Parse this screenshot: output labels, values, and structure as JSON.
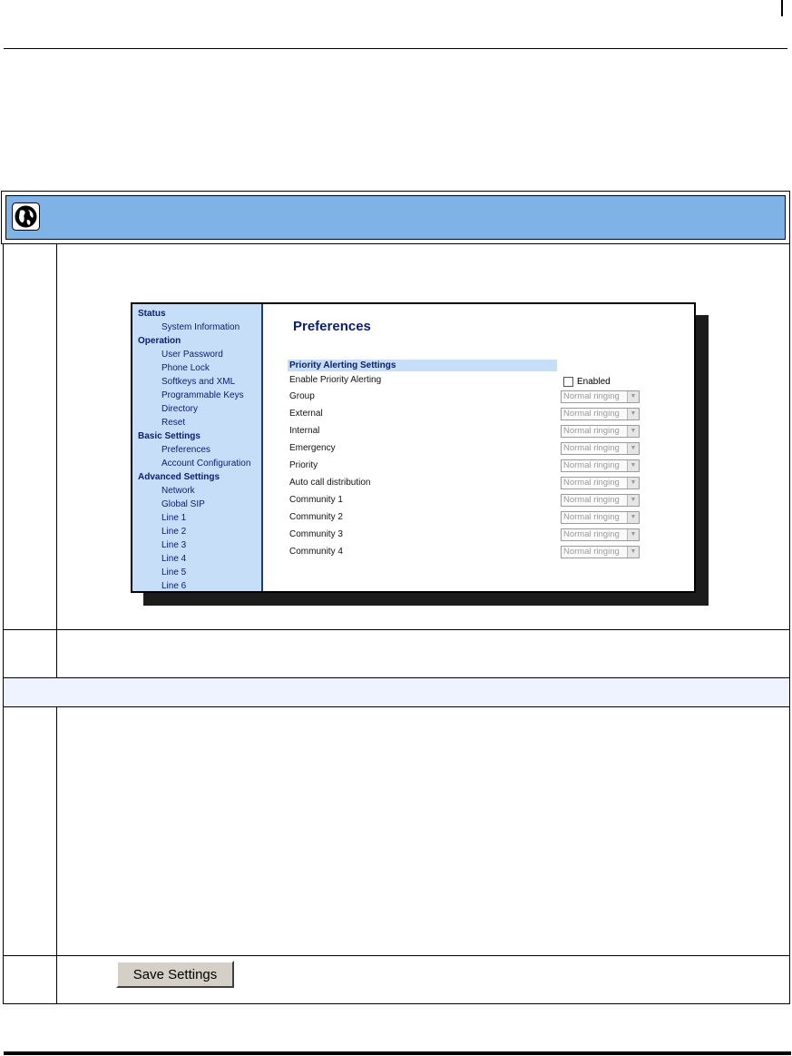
{
  "icons": {
    "banner": "globe-icon",
    "select_arrow": "dropdown-arrow-icon"
  },
  "colors": {
    "banner": "#7fb2e5",
    "nav_bg": "#c6def8",
    "nav_text": "#0b1e6e"
  },
  "nav": {
    "items": [
      {
        "label": "Status",
        "type": "head"
      },
      {
        "label": "System Information",
        "type": "item"
      },
      {
        "label": "Operation",
        "type": "head"
      },
      {
        "label": "User Password",
        "type": "item"
      },
      {
        "label": "Phone Lock",
        "type": "item"
      },
      {
        "label": "Softkeys and XML",
        "type": "item"
      },
      {
        "label": "Programmable Keys",
        "type": "item"
      },
      {
        "label": "Directory",
        "type": "item"
      },
      {
        "label": "Reset",
        "type": "item"
      },
      {
        "label": "Basic Settings",
        "type": "head"
      },
      {
        "label": "Preferences",
        "type": "item"
      },
      {
        "label": "Account Configuration",
        "type": "item"
      },
      {
        "label": "Advanced Settings",
        "type": "head"
      },
      {
        "label": "Network",
        "type": "item"
      },
      {
        "label": "Global SIP",
        "type": "item"
      },
      {
        "label": "Line 1",
        "type": "item"
      },
      {
        "label": "Line 2",
        "type": "item"
      },
      {
        "label": "Line 3",
        "type": "item"
      },
      {
        "label": "Line 4",
        "type": "item"
      },
      {
        "label": "Line 5",
        "type": "item"
      },
      {
        "label": "Line 6",
        "type": "item"
      }
    ]
  },
  "main": {
    "title": "Preferences",
    "section": "Priority Alerting Settings",
    "enable_row": {
      "label": "Enable Priority Alerting",
      "checkbox_label": "Enabled",
      "checked": false
    },
    "select_value": "Normal ringing",
    "rows": [
      {
        "label": "Group"
      },
      {
        "label": "External"
      },
      {
        "label": "Internal"
      },
      {
        "label": "Emergency"
      },
      {
        "label": "Priority"
      },
      {
        "label": "Auto call distribution"
      },
      {
        "label": "Community 1"
      },
      {
        "label": "Community 2"
      },
      {
        "label": "Community 3"
      },
      {
        "label": "Community 4"
      }
    ]
  },
  "save_button": {
    "label": "Save Settings"
  }
}
